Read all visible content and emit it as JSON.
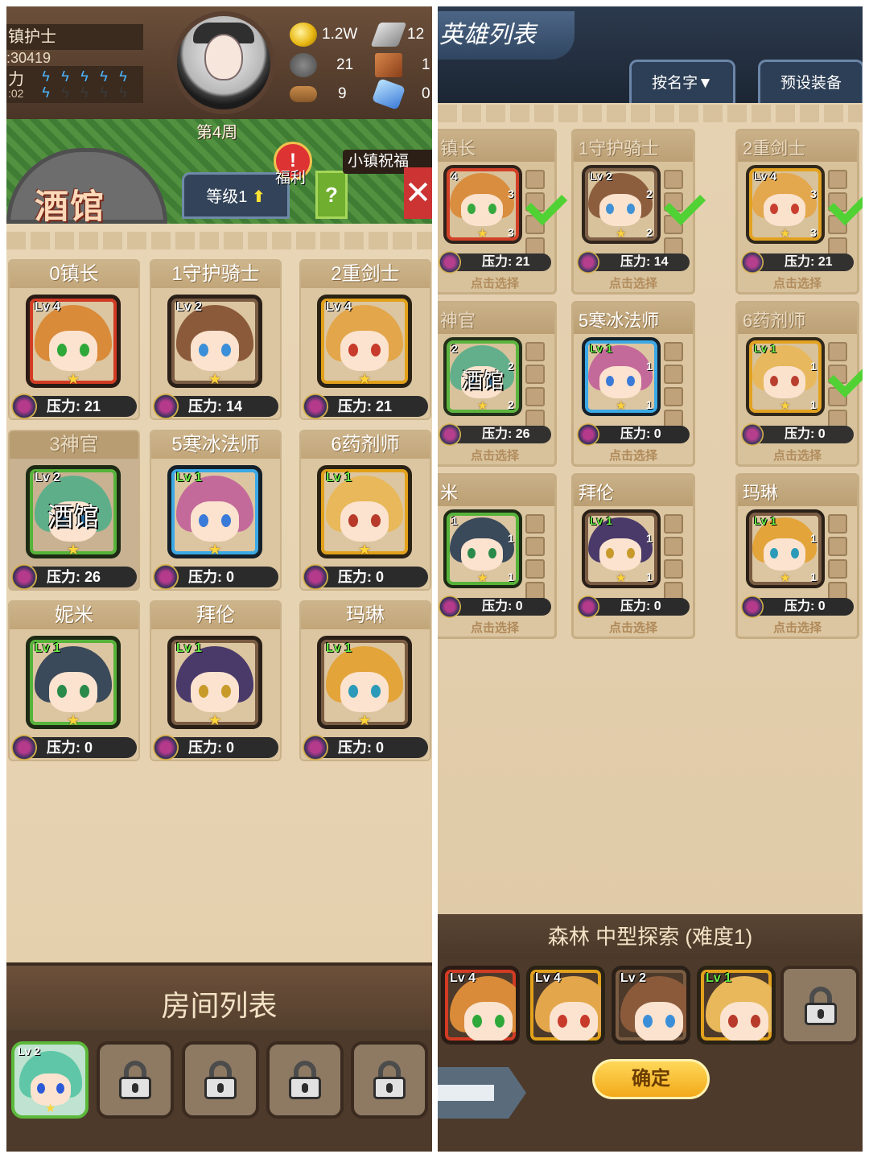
{
  "left": {
    "header": {
      "name": "镇护士",
      "id": ":30419",
      "power_label": "力",
      "power_sub": ":02",
      "week": "第4周",
      "resources": [
        {
          "icon": "gold-coin-icon",
          "value": "1.2W"
        },
        {
          "icon": "iron-ingot-icon",
          "value": "12"
        },
        {
          "icon": "stone-ore-icon",
          "value": "21"
        },
        {
          "icon": "leather-scroll-icon",
          "value": "1"
        },
        {
          "icon": "wood-log-icon",
          "value": "9"
        },
        {
          "icon": "crystal-icon",
          "value": "0"
        }
      ]
    },
    "town": {
      "tavern_title": "酒馆",
      "level_label": "等级1",
      "welfare_label": "福利",
      "bless_label": "小镇祝福",
      "help_label": "?"
    },
    "heroes": [
      {
        "title": "0镇长",
        "level": "Lv 4",
        "pressure": "压力: 21",
        "frame": "red",
        "hair": "#d98b3a",
        "eye": "#2fa83a",
        "dim": false
      },
      {
        "title": "1守护骑士",
        "level": "Lv 2",
        "pressure": "压力: 14",
        "frame": "brown",
        "hair": "#8a5a3a",
        "eye": "#3a8fd8",
        "dim": false
      },
      {
        "title": "2重剑士",
        "level": "Lv 4",
        "pressure": "压力: 21",
        "frame": "gold",
        "hair": "#e3a64a",
        "eye": "#c83a2a",
        "dim": false
      },
      {
        "title": "3神官",
        "level": "Lv 2",
        "pressure": "压力: 26",
        "frame": "green",
        "hair": "#5fae8a",
        "eye": "#2a6a9a",
        "dim": true,
        "overlay": "酒馆"
      },
      {
        "title": "5寒冰法师",
        "level": "Lv 1",
        "pressure": "压力: 0",
        "frame": "blue",
        "hair": "#c46a9a",
        "eye": "#3a7ad8",
        "dim": false
      },
      {
        "title": "6药剂师",
        "level": "Lv 1",
        "pressure": "压力: 0",
        "frame": "gold",
        "hair": "#e8b85a",
        "eye": "#b83a2a",
        "dim": false
      },
      {
        "title": "妮米",
        "level": "Lv 1",
        "pressure": "压力: 0",
        "frame": "green",
        "hair": "#3a4a5a",
        "eye": "#2a8a4a",
        "dim": false
      },
      {
        "title": "拜伦",
        "level": "Lv 1",
        "pressure": "压力: 0",
        "frame": "brown",
        "hair": "#4a3a6a",
        "eye": "#c89a2a",
        "dim": false
      },
      {
        "title": "玛琳",
        "level": "Lv 1",
        "pressure": "压力: 0",
        "frame": "brown",
        "hair": "#e3a43a",
        "eye": "#2a9ab8",
        "dim": false
      }
    ],
    "room_list": {
      "title": "房间列表",
      "slot1_level": "Lv 2"
    }
  },
  "right": {
    "title": "英雄列表",
    "sort_tab": "按名字▼",
    "preset_tab": "预设装备",
    "select_text": "点击选择",
    "heroes": [
      {
        "title": "镇长",
        "level": "4",
        "pressure": "压力: 21",
        "frame": "red",
        "hair": "#d98b3a",
        "eye": "#2fa83a",
        "gear": [
          "3",
          "3"
        ],
        "checked": true,
        "dim": true
      },
      {
        "title": "1守护骑士",
        "level": "Lv 2",
        "pressure": "压力: 14",
        "frame": "brown",
        "hair": "#8a5a3a",
        "eye": "#3a8fd8",
        "gear": [
          "2",
          "2"
        ],
        "checked": true,
        "dim": true
      },
      {
        "title": "2重剑士",
        "level": "Lv 4",
        "pressure": "压力: 21",
        "frame": "gold",
        "hair": "#e3a64a",
        "eye": "#c83a2a",
        "gear": [
          "3",
          "3"
        ],
        "checked": true,
        "dim": true
      },
      {
        "title": "神官",
        "level": "2",
        "pressure": "压力: 26",
        "frame": "green",
        "hair": "#5fae8a",
        "eye": "#2a6a9a",
        "gear": [
          "2",
          "2"
        ],
        "checked": false,
        "dim": true,
        "overlay": "酒馆"
      },
      {
        "title": "5寒冰法师",
        "level": "Lv 1",
        "pressure": "压力: 0",
        "frame": "blue",
        "hair": "#c46a9a",
        "eye": "#3a7ad8",
        "gear": [
          "1",
          "1"
        ],
        "checked": false,
        "dim": false
      },
      {
        "title": "6药剂师",
        "level": "Lv 1",
        "pressure": "压力: 0",
        "frame": "gold",
        "hair": "#e8b85a",
        "eye": "#b83a2a",
        "gear": [
          "1",
          "1"
        ],
        "checked": true,
        "dim": true
      },
      {
        "title": "米",
        "level": "1",
        "pressure": "压力: 0",
        "frame": "green",
        "hair": "#3a4a5a",
        "eye": "#2a8a4a",
        "gear": [
          "1",
          "1"
        ],
        "checked": false,
        "dim": false
      },
      {
        "title": "拜伦",
        "level": "Lv 1",
        "pressure": "压力: 0",
        "frame": "brown",
        "hair": "#4a3a6a",
        "eye": "#c89a2a",
        "gear": [
          "1",
          "1"
        ],
        "checked": false,
        "dim": false
      },
      {
        "title": "玛琳",
        "level": "Lv 1",
        "pressure": "压力: 0",
        "frame": "brown",
        "hair": "#e3a43a",
        "eye": "#2a9ab8",
        "gear": [
          "1",
          "1"
        ],
        "checked": false,
        "dim": false
      }
    ],
    "explore": {
      "title": "森林 中型探索 (难度1)",
      "slots": [
        {
          "level": "Lv 4",
          "frame": "red",
          "hair": "#d98b3a",
          "eye": "#2fa83a"
        },
        {
          "level": "Lv 4",
          "frame": "gold",
          "hair": "#e3a64a",
          "eye": "#c83a2a"
        },
        {
          "level": "Lv 2",
          "frame": "brown",
          "hair": "#8a5a3a",
          "eye": "#3a8fd8"
        },
        {
          "level": "Lv 1",
          "frame": "gold",
          "hair": "#e8b85a",
          "eye": "#b83a2a"
        }
      ],
      "confirm": "确定"
    }
  }
}
